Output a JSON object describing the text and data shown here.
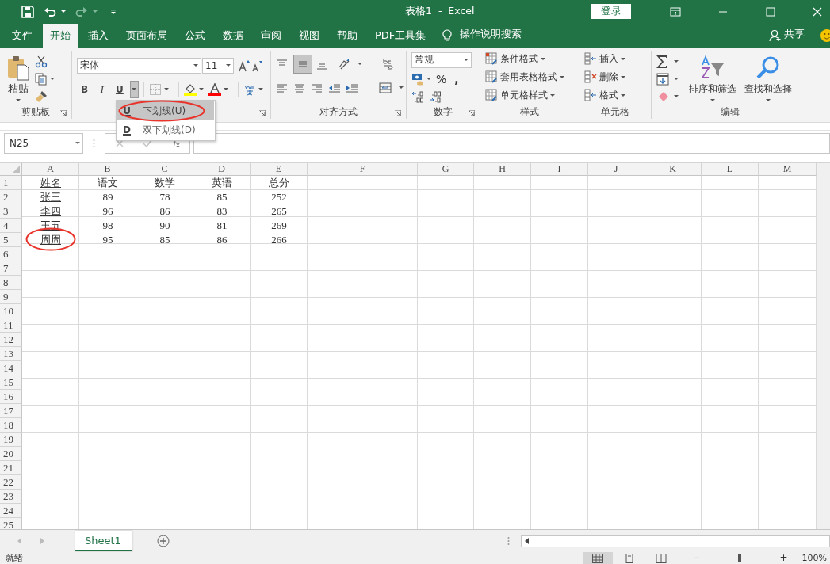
{
  "title_bar": {
    "title": "表格1  -  Excel",
    "login": "登录"
  },
  "tabs": [
    {
      "label": "文件",
      "selected": false
    },
    {
      "label": "开始",
      "selected": true
    },
    {
      "label": "插入",
      "selected": false
    },
    {
      "label": "页面布局",
      "selected": false
    },
    {
      "label": "公式",
      "selected": false
    },
    {
      "label": "数据",
      "selected": false
    },
    {
      "label": "审阅",
      "selected": false
    },
    {
      "label": "视图",
      "selected": false
    },
    {
      "label": "帮助",
      "selected": false
    },
    {
      "label": "PDF工具集",
      "selected": false
    }
  ],
  "tell_me": "操作说明搜索",
  "share": "共享",
  "ribbon": {
    "clipboard": {
      "paste": "粘贴",
      "label": "剪贴板"
    },
    "font": {
      "name": "宋体",
      "size": "11",
      "styles": [
        "B",
        "I",
        "U"
      ],
      "underline_menu_open": true
    },
    "alignment": {
      "label": "对齐方式",
      "middle_align_on": true
    },
    "number": {
      "format": "常规",
      "percent": "%",
      "comma": ",",
      "label": "数字"
    },
    "styles": {
      "items": [
        "条件格式",
        "套用表格格式",
        "单元格样式"
      ],
      "label": "样式"
    },
    "cells": {
      "items": [
        "插入",
        "删除",
        "格式"
      ],
      "label": "单元格"
    },
    "editing": {
      "sort": "排序和筛选",
      "find": "查找和选择",
      "label": "编辑"
    }
  },
  "underline_menu": [
    {
      "key": "U",
      "label": "下划线(U)",
      "highlighted": true,
      "circled": true
    },
    {
      "key": "D",
      "label": "双下划线(D)",
      "highlighted": false,
      "circled": false
    }
  ],
  "name_box": "N25",
  "sheet": {
    "columns": [
      "A",
      "B",
      "C",
      "D",
      "E",
      "F",
      "G",
      "H",
      "I",
      "J",
      "K",
      "L",
      "M"
    ],
    "row_numbers": [
      "1",
      "2",
      "3",
      "4",
      "5",
      "6",
      "7",
      "8",
      "9",
      "10",
      "11",
      "12",
      "13",
      "14",
      "15",
      "16",
      "17",
      "18",
      "19",
      "20",
      "21",
      "22",
      "23",
      "24",
      "25"
    ],
    "rows": [
      {
        "cells": [
          "姓名",
          "语文",
          "数学",
          "英语",
          "总分"
        ],
        "underlined": true,
        "circled": false
      },
      {
        "cells": [
          "张三",
          "89",
          "78",
          "85",
          "252"
        ],
        "underlined": true,
        "circled": false
      },
      {
        "cells": [
          "李四",
          "96",
          "86",
          "83",
          "265"
        ],
        "underlined": true,
        "circled": false
      },
      {
        "cells": [
          "王五",
          "98",
          "90",
          "81",
          "269"
        ],
        "underlined": true,
        "circled": false
      },
      {
        "cells": [
          "周周",
          "95",
          "85",
          "86",
          "266"
        ],
        "underlined": true,
        "circled": true
      }
    ]
  },
  "sheet_tabs": [
    {
      "label": "Sheet1",
      "selected": true
    }
  ],
  "status_bar": {
    "status": "就绪",
    "zoom_out": "−",
    "zoom_in": "+",
    "zoom": {
      "level": 0.5
    },
    "zoom_label": "100%"
  }
}
